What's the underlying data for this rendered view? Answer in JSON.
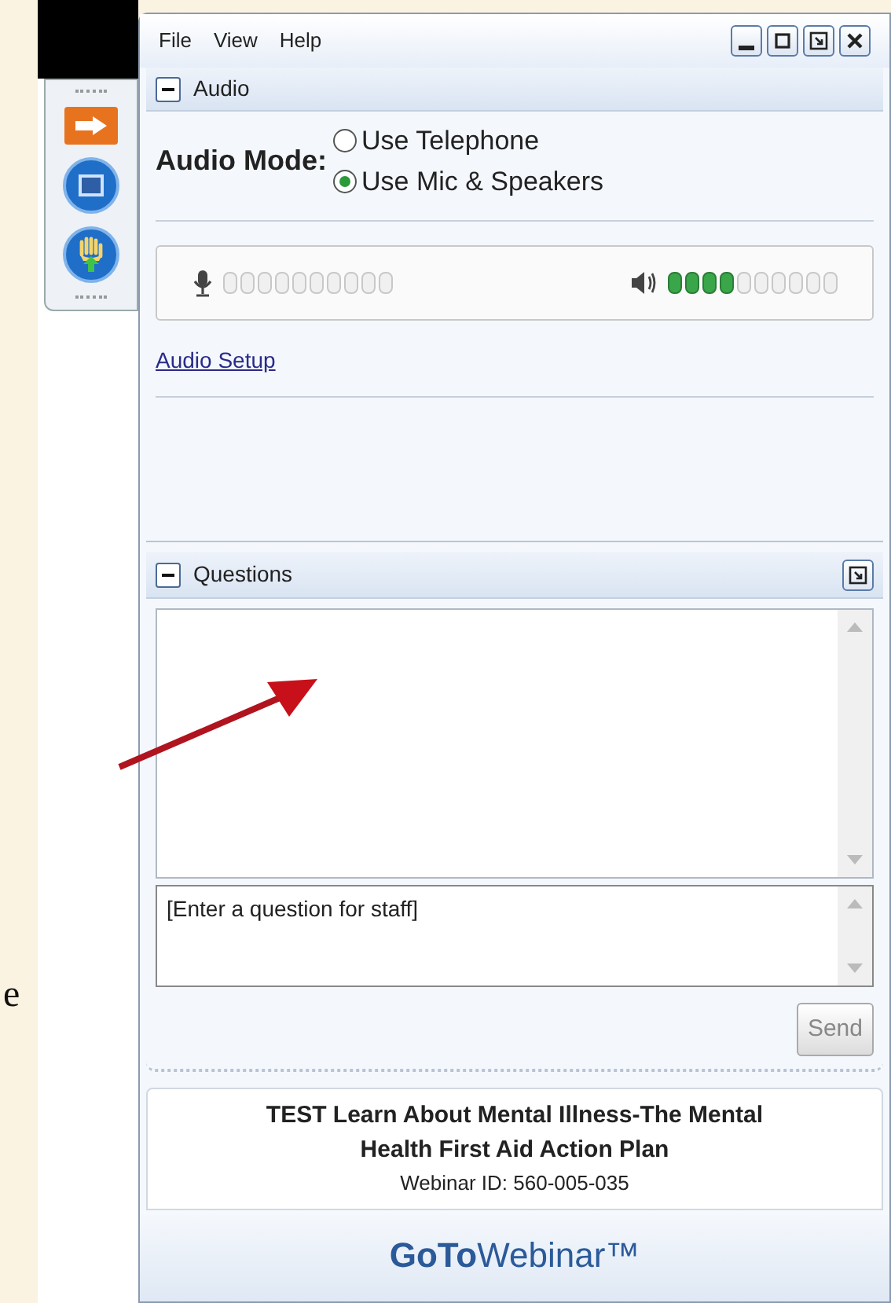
{
  "slide_text": "e",
  "menu": [
    "File",
    "View",
    "Help"
  ],
  "window_controls": [
    {
      "kind": "minimize"
    },
    {
      "kind": "maximize"
    },
    {
      "kind": "restore"
    },
    {
      "kind": "close"
    }
  ],
  "toolbar": [
    {
      "kind": "arrow"
    },
    {
      "kind": "screen"
    },
    {
      "kind": "hand"
    }
  ],
  "audio": {
    "title": "Audio",
    "expanded": true,
    "mode_label": "Audio Mode:",
    "options": [
      {
        "label": "Use Telephone",
        "selected": false
      },
      {
        "label": "Use Mic & Speakers",
        "selected": true
      }
    ],
    "meters": [
      {
        "kind": "mic"
      },
      {
        "kind": "speaker",
        "level": 0.4
      }
    ],
    "setup_link": "Audio Setup"
  },
  "questions": {
    "title": "Questions",
    "expanded": true,
    "placeholder": "[Enter a question for staff]",
    "send": "Send"
  },
  "webinar": {
    "title": "TEST Learn About Mental Illness-The Mental Health First Aid Action Plan",
    "id": "Webinar ID: 560-005-035",
    "logo": "**GoTo**Webinar™"
  }
}
